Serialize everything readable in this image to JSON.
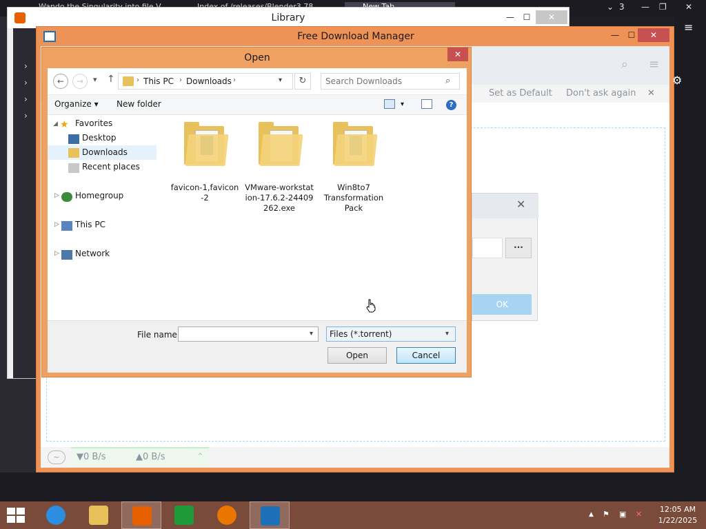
{
  "browser": {
    "tabs": [
      "Wando the Singularity into file V...",
      "Index of /releases/Blender3.78...",
      "New Tab"
    ],
    "tab_count": "3"
  },
  "library": {
    "title": "Library",
    "minimize": "—",
    "maximize": "☐",
    "close": "✕"
  },
  "fdm": {
    "title": "Free Download Manager",
    "minimize": "—",
    "maximize": "☐",
    "close": "✕",
    "notice": {
      "set_default": "Set as Default",
      "dont_ask": "Don't ask again",
      "close": "✕"
    },
    "status": {
      "down_speed": "▼0 B/s",
      "up_speed": "▲0 B/s"
    },
    "add_dialog": {
      "close": "✕",
      "browse": "···",
      "ok": "OK"
    }
  },
  "open_dialog": {
    "title": "Open",
    "close": "✕",
    "address": {
      "this_pc": "This PC",
      "downloads": "Downloads"
    },
    "search_placeholder": "Search Downloads",
    "commands": {
      "organize": "Organize ▾",
      "new_folder": "New folder"
    },
    "nav": [
      {
        "label": "Favorites"
      },
      {
        "label": "Desktop"
      },
      {
        "label": "Downloads"
      },
      {
        "label": "Recent places"
      },
      {
        "label": "Homegroup"
      },
      {
        "label": "This PC"
      },
      {
        "label": "Network"
      }
    ],
    "files": [
      {
        "name": "favicon-1,favicon-2"
      },
      {
        "name": "VMware-workstation-17.6.2-24409262.exe"
      },
      {
        "name": "Win8to7 Transformation Pack"
      }
    ],
    "file_name_label": "File name:",
    "file_name_value": "",
    "filter": "Files (*.torrent)",
    "open_button": "Open",
    "cancel_button": "Cancel"
  },
  "taskbar": {
    "clock_time": "12:05 AM",
    "clock_date": "1/22/2025"
  }
}
